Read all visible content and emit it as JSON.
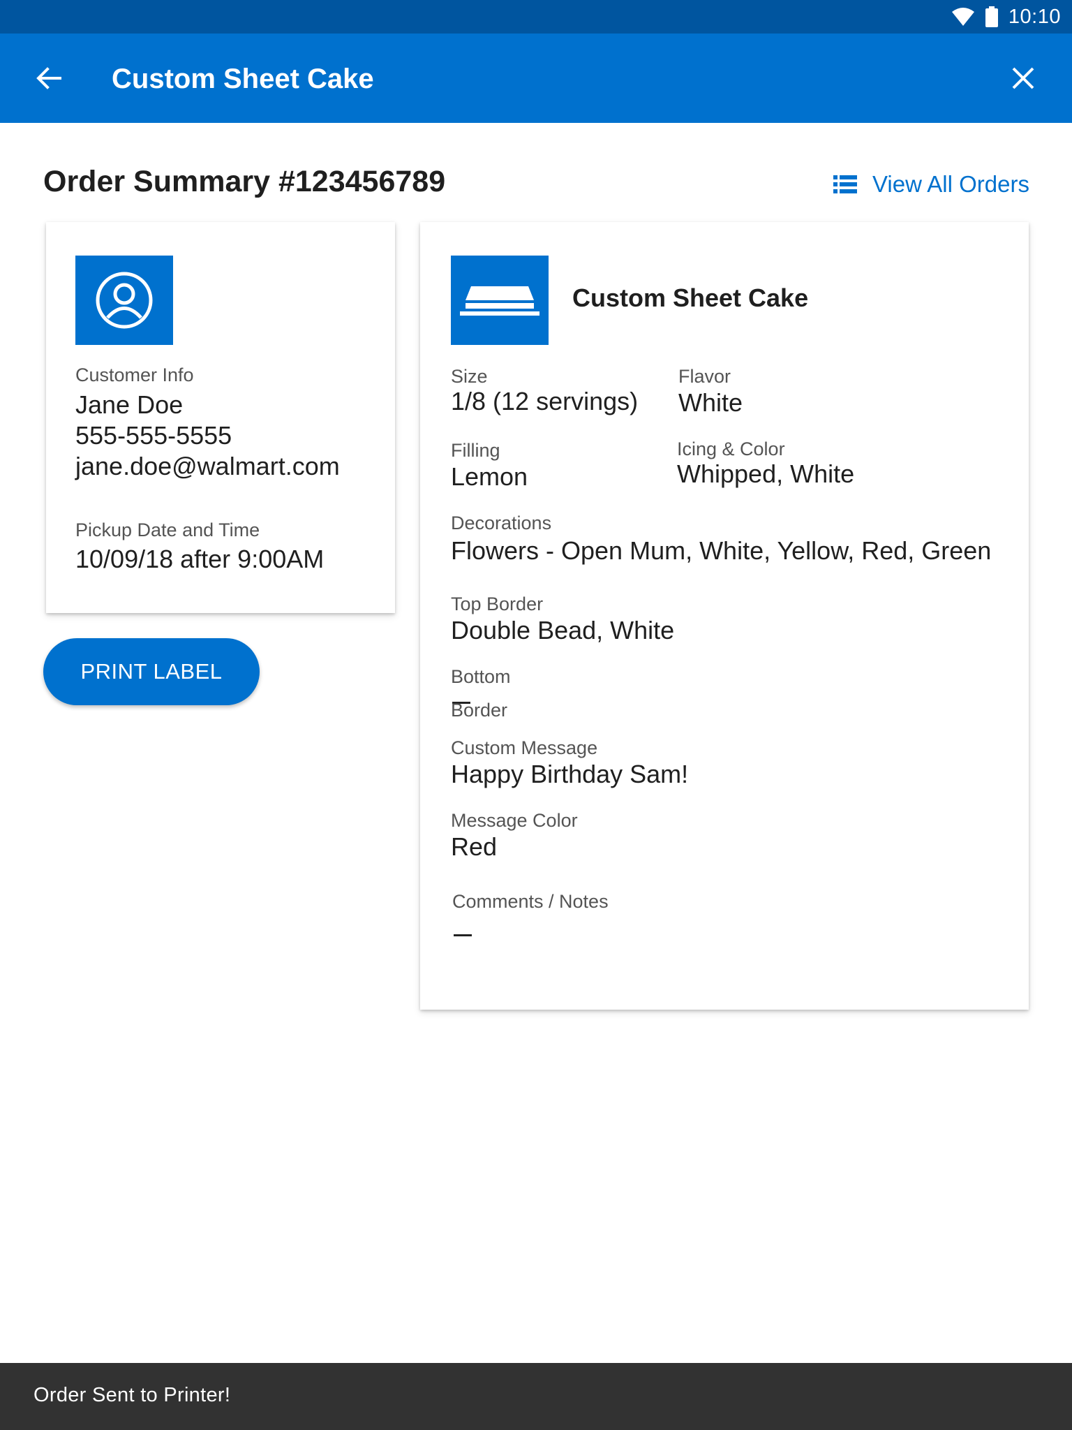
{
  "status_bar": {
    "time": "10:10",
    "icons": [
      "wifi-icon",
      "battery-icon"
    ]
  },
  "app_bar": {
    "title": "Custom Sheet Cake",
    "back_icon": "arrow-back-icon",
    "close_icon": "close-icon"
  },
  "header": {
    "title": "Order Summary #123456789",
    "view_all_label": "View All Orders",
    "view_all_icon": "list-icon"
  },
  "customer": {
    "icon": "account-circle-icon",
    "info_label": "Customer Info",
    "name": "Jane Doe",
    "phone": "555-555-5555",
    "email": "jane.doe@walmart.com",
    "pickup_label": "Pickup Date and Time",
    "pickup_value": "10/09/18 after 9:00AM"
  },
  "actions": {
    "print_label": "PRINT LABEL"
  },
  "order": {
    "icon": "sheet-cake-icon",
    "product_title": "Custom Sheet Cake",
    "size_label": "Size",
    "size_value": "1/8 (12 servings)",
    "flavor_label": "Flavor",
    "flavor_value": "White",
    "filling_label": "Filling",
    "filling_value": "Lemon",
    "icing_label": "Icing & Color",
    "icing_value": "Whipped, White",
    "decorations_label": "Decorations",
    "decorations_value": "Flowers - Open Mum, White, Yellow, Red, Green",
    "top_border_label": "Top Border",
    "top_border_value": "Double Bead, White",
    "bottom_border_label_line1": "Bottom",
    "bottom_border_label_line2": "Border",
    "custom_message_label": "Custom Message",
    "custom_message_value": "Happy Birthday Sam!",
    "message_color_label": "Message Color",
    "message_color_value": "Red",
    "comments_label": "Comments / Notes"
  },
  "snackbar": {
    "message": "Order Sent to Printer!"
  },
  "colors": {
    "status_bar": "#00559f",
    "primary": "#0071ce",
    "snackbar": "#323232"
  }
}
